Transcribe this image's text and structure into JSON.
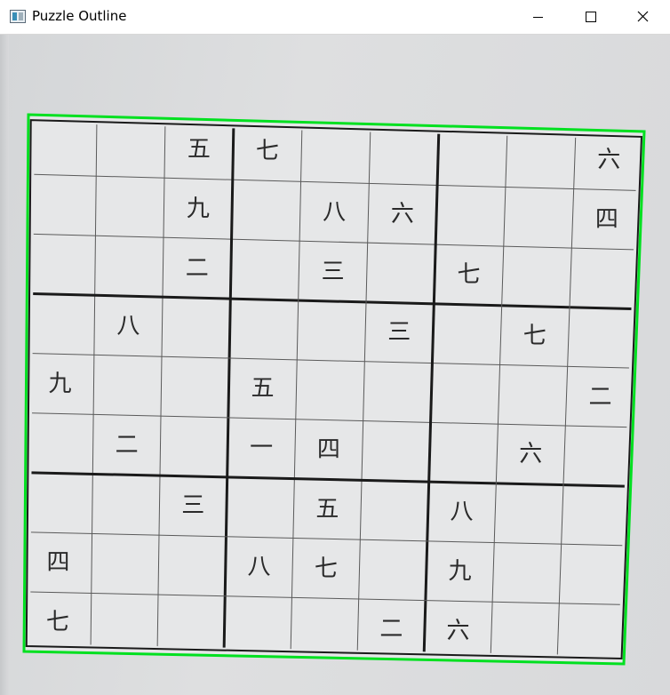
{
  "window": {
    "title": "Puzzle Outline",
    "controls": [
      "minimize-icon",
      "maximize-icon",
      "close-icon"
    ]
  },
  "colors": {
    "outline": "#00e020",
    "grid_thin": "#5a5a5a",
    "grid_thick": "#1a1a1a",
    "paper": "#e6e7e8"
  },
  "puzzle": {
    "rows": [
      [
        "",
        "",
        "五",
        "七",
        "",
        "",
        "",
        "",
        "六"
      ],
      [
        "",
        "",
        "九",
        "",
        "八",
        "六",
        "",
        "",
        "四"
      ],
      [
        "",
        "",
        "二",
        "",
        "三",
        "",
        "七",
        "",
        ""
      ],
      [
        "",
        "八",
        "",
        "",
        "",
        "三",
        "",
        "七",
        ""
      ],
      [
        "九",
        "",
        "",
        "五",
        "",
        "",
        "",
        "",
        "二"
      ],
      [
        "",
        "二",
        "",
        "一",
        "四",
        "",
        "",
        "六",
        ""
      ],
      [
        "",
        "",
        "三",
        "",
        "五",
        "",
        "八",
        "",
        ""
      ],
      [
        "四",
        "",
        "",
        "八",
        "七",
        "",
        "九",
        "",
        ""
      ],
      [
        "七",
        "",
        "",
        "",
        "",
        "二",
        "六",
        "",
        ""
      ]
    ]
  }
}
